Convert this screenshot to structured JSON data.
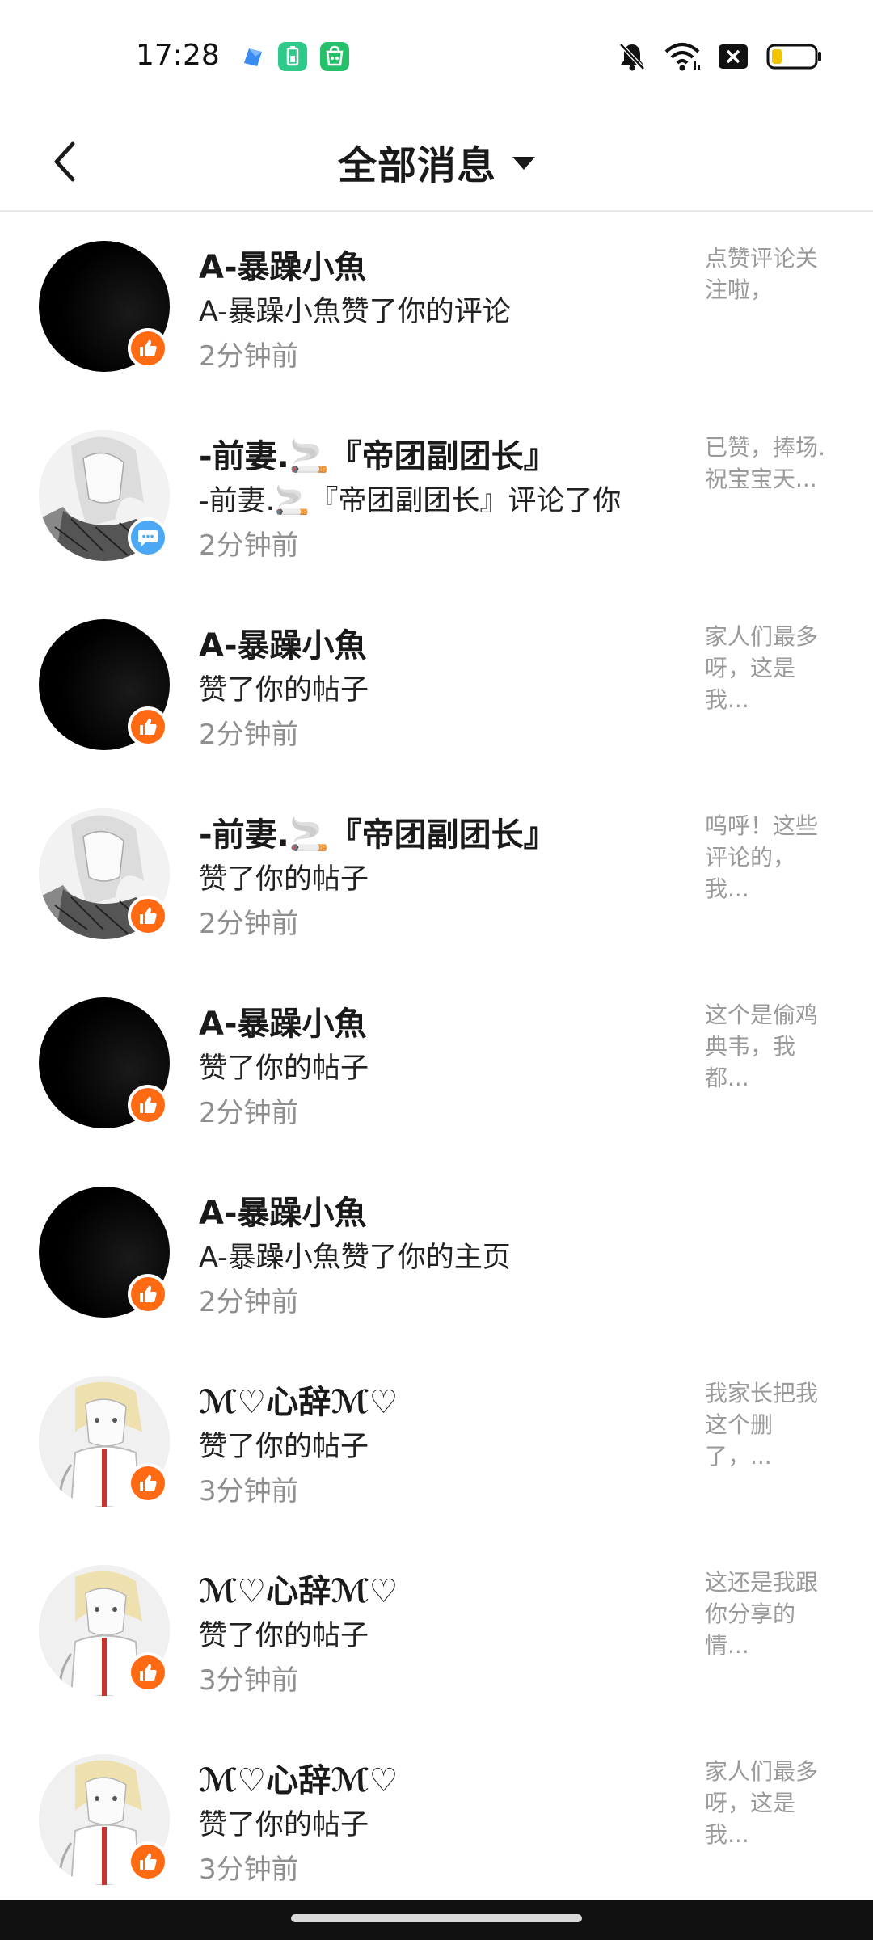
{
  "status_bar": {
    "time": "17:28",
    "app_icons": [
      {
        "name": "blue-app-icon",
        "color": "#3b8cf0"
      },
      {
        "name": "battery-app-icon",
        "color": "#2fc98a"
      },
      {
        "name": "shop-app-icon",
        "color": "#27c06a"
      }
    ],
    "icons": [
      "bell-muted-icon",
      "wifi-icon",
      "close-box-icon",
      "battery-icon"
    ],
    "battery_color": "#f2c400"
  },
  "header": {
    "title": "全部消息",
    "back_icon": "chevron-left-icon",
    "dropdown_icon": "caret-down-icon"
  },
  "colors": {
    "like_badge": "#ff6a13",
    "comment_badge": "#4ca8f5"
  },
  "messages": [
    {
      "avatar": "black",
      "badge": "like",
      "name": "A-暴躁小魚",
      "action": "A-暴躁小魚赞了你的评论",
      "time": "2分钟前",
      "preview": "点赞评论关注啦，"
    },
    {
      "avatar": "anime-girl-sketch",
      "badge": "comment",
      "name": "-前妻.🚬『帝团副团长』",
      "action": "-前妻.🚬『帝团副团长』评论了你",
      "time": "2分钟前",
      "preview": "已赞，捧场. 祝宝宝天..."
    },
    {
      "avatar": "black",
      "badge": "like",
      "name": "A-暴躁小魚",
      "action": "赞了你的帖子",
      "time": "2分钟前",
      "preview": "家人们最多呀，这是我..."
    },
    {
      "avatar": "anime-girl-sketch",
      "badge": "like",
      "name": "-前妻.🚬『帝团副团长』",
      "action": "赞了你的帖子",
      "time": "2分钟前",
      "preview": "呜呼！这些评论的，我..."
    },
    {
      "avatar": "black",
      "badge": "like",
      "name": "A-暴躁小魚",
      "action": "赞了你的帖子",
      "time": "2分钟前",
      "preview": "这个是偷鸡典韦，我都..."
    },
    {
      "avatar": "black",
      "badge": "like",
      "name": "A-暴躁小魚",
      "action": "A-暴躁小魚赞了你的主页",
      "time": "2分钟前",
      "preview": ""
    },
    {
      "avatar": "anime-girl-blonde",
      "badge": "like",
      "name": "ℳ♡心辞ℳ♡",
      "action": "赞了你的帖子",
      "time": "3分钟前",
      "preview": "我家长把我这个删了，..."
    },
    {
      "avatar": "anime-girl-blonde",
      "badge": "like",
      "name": "ℳ♡心辞ℳ♡",
      "action": "赞了你的帖子",
      "time": "3分钟前",
      "preview": "这还是我跟你分享的情..."
    },
    {
      "avatar": "anime-girl-blonde",
      "badge": "like",
      "name": "ℳ♡心辞ℳ♡",
      "action": "赞了你的帖子",
      "time": "3分钟前",
      "preview": "家人们最多呀，这是我..."
    }
  ]
}
